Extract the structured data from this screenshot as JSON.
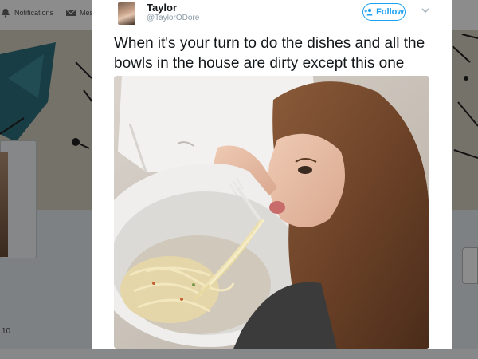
{
  "background": {
    "nav": [
      {
        "label": "Notifications",
        "icon": "bell-icon"
      },
      {
        "label": "Mes",
        "icon": "envelope-icon"
      }
    ],
    "count": "10"
  },
  "tweet": {
    "display_name": "Taylor",
    "handle": "@TaylorODore",
    "follow_label": "Follow",
    "text": "When it's your turn to do the dishes and all the bowls in the house are dirty except this one"
  },
  "colors": {
    "accent": "#1da1f2",
    "text": "#14171a",
    "muted": "#8899a6"
  }
}
